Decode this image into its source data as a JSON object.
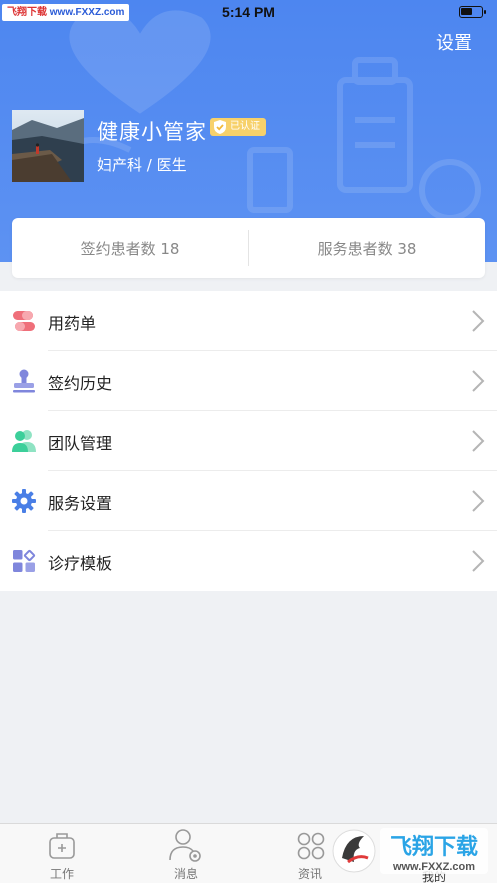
{
  "status_bar": {
    "watermark_brand": "飞翔下载",
    "watermark_url": "www.FXXZ.com",
    "time": "5:14 PM",
    "battery_icon": "battery-icon"
  },
  "header": {
    "settings_label": "设置",
    "name": "健康小管家",
    "verified_label": "已认证",
    "dept": "妇产科 / 医生",
    "bg_color": "#4d86f0"
  },
  "stats": {
    "signed": "签约患者数 18",
    "served": "服务患者数 38"
  },
  "menu": {
    "items": [
      {
        "label": "用药单",
        "icon": "pill-icon"
      },
      {
        "label": "签约历史",
        "icon": "stamp-icon"
      },
      {
        "label": "团队管理",
        "icon": "team-icon"
      },
      {
        "label": "服务设置",
        "icon": "gear-icon"
      },
      {
        "label": "诊疗模板",
        "icon": "template-icon"
      }
    ]
  },
  "tabbar": {
    "tabs": [
      {
        "label": "工作",
        "icon": "briefcase-icon"
      },
      {
        "label": "消息",
        "icon": "user-gear-icon"
      },
      {
        "label": "资讯",
        "icon": "grid-circles-icon"
      },
      {
        "label": "我的",
        "icon": "profile-icon"
      }
    ]
  },
  "overlay_logo": {
    "text": "飞翔下载",
    "url": "www.FXXZ.com"
  }
}
